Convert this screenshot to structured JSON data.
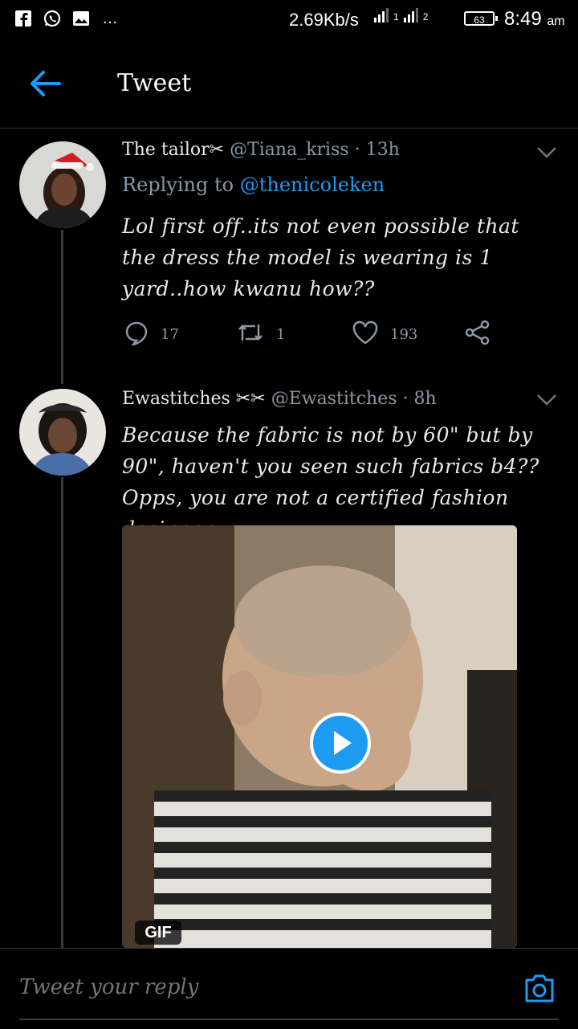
{
  "status_bar": {
    "speed": "2.69Kb/s",
    "sim1": "1",
    "sim2": "2",
    "battery": "63",
    "time": "8:49",
    "ampm": "am"
  },
  "header": {
    "title": "Tweet"
  },
  "tweet1": {
    "name": "The tailor✂",
    "handle": "@Tiana_kriss",
    "time": "· 13h",
    "replying_prefix": "Replying to",
    "replying_handle": "@thenicoleken",
    "text": "Lol first off..its not even possible that the dress the model is wearing is 1 yard..how kwanu how??",
    "replies": "17",
    "retweets": "1",
    "likes": "193"
  },
  "tweet2": {
    "name": "Ewastitches ✂✂",
    "handle": "@Ewastitches",
    "time": "· 8h",
    "text": "Because the fabric is not by 60\" but by 90\", haven't you seen such fabrics b4?? Opps, you are not a certified fashion designer",
    "media_badge": "GIF"
  },
  "reply_bar": {
    "placeholder": "Tweet your reply"
  },
  "colors": {
    "accent": "#1d9bf0",
    "background": "#000000",
    "muted": "#8b98a5"
  }
}
